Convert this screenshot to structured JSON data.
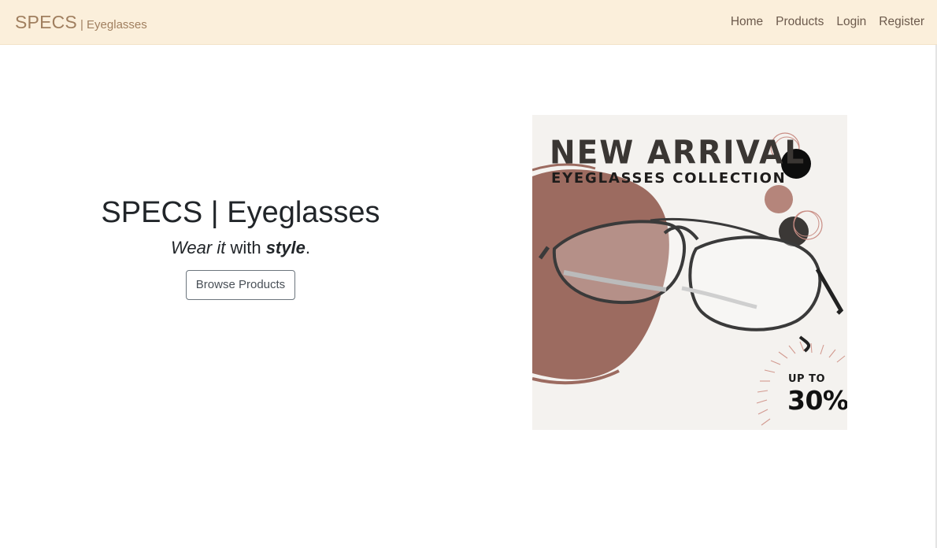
{
  "navbar": {
    "brand_main": "SPECS",
    "brand_sub": "| Eyeglasses",
    "links": [
      "Home",
      "Products",
      "Login",
      "Register"
    ],
    "background": "#fbefdb",
    "brand_color": "#a07f5f"
  },
  "hero": {
    "title": "SPECS | Eyeglasses",
    "tagline": {
      "part1": "Wear",
      "part2": "it",
      "part3": "with",
      "part4": "style",
      "part5": "."
    },
    "button_label": "Browse Products"
  },
  "banner": {
    "title": "NEW ARRIVAL",
    "subtitle": "EYEGLASSES COLLECTION",
    "promo_prefix": "UP TO",
    "promo_value": "30%",
    "accent_color": "#9c6b60"
  }
}
